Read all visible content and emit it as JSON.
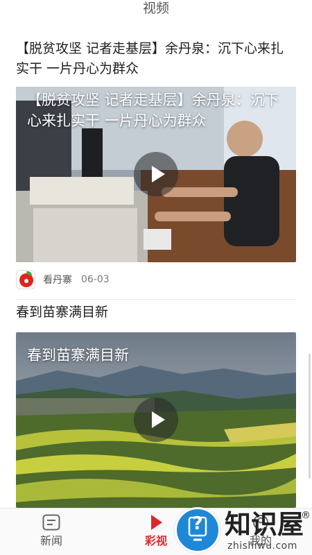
{
  "header": {
    "title": "视频"
  },
  "feed": {
    "items": [
      {
        "title": "【脱贫攻坚 记者走基层】余丹泉：沉下心来扎实干 一片丹心为群众",
        "overlay_title": "【脱贫攻坚 记者走基层】余丹泉：沉下心来扎实干 一片丹心为群众",
        "source": "看丹寨",
        "date": "06-03"
      },
      {
        "title": "春到苗寨满目新",
        "overlay_title": "春到苗寨满目新"
      }
    ]
  },
  "tabbar": {
    "tabs": [
      {
        "label": "新闻",
        "icon": "news-icon",
        "active": false
      },
      {
        "label": "彩视",
        "icon": "video-play-icon",
        "active": true
      },
      {
        "label": "我的",
        "icon": "profile-icon",
        "active": false
      }
    ]
  },
  "watermark": {
    "brand": "知识屋",
    "reg": "®",
    "domain": "zhishiwu.com",
    "icon": "question-monitor-icon"
  },
  "colors": {
    "accent": "#e0262c",
    "watermark_blue": "#1e88d6"
  }
}
